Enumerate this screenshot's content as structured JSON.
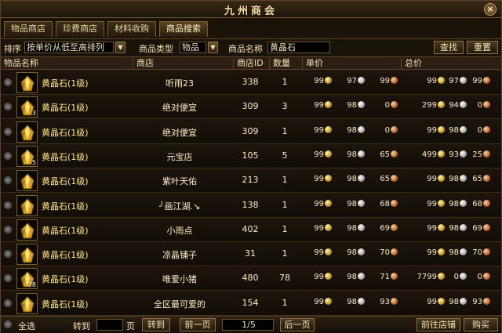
{
  "window": {
    "title": "九州商会",
    "close_label": "×"
  },
  "tabs": [
    {
      "label": "物品商店"
    },
    {
      "label": "珍费商店"
    },
    {
      "label": "材料收购"
    },
    {
      "label": "商品搜索"
    }
  ],
  "filters": {
    "sort_label": "排序",
    "sort_value": "按单价从低至高排列",
    "type_label": "商品类型",
    "type_value": "物品",
    "name_label": "商品名称",
    "name_value": "黄晶石",
    "search_button": "查找",
    "reset_button": "重置"
  },
  "columns": [
    "物品名称",
    "商店",
    "商店ID",
    "数量",
    "单价",
    "总价"
  ],
  "colors": {
    "gold": "#d8a52a",
    "silver": "#b0b0b0",
    "copper": "#b9672f"
  },
  "rows": [
    {
      "name": "黄晶石(1级)",
      "stack": "",
      "shop": "听雨23",
      "shop_id": "338",
      "qty": "1",
      "unit": [
        "99",
        "97",
        "99"
      ],
      "total": [
        "99",
        "97",
        "99"
      ]
    },
    {
      "name": "黄晶石(1级)",
      "stack": "3",
      "shop": "绝对便宜",
      "shop_id": "309",
      "qty": "3",
      "unit": [
        "99",
        "98",
        "0"
      ],
      "total": [
        "299",
        "94",
        "0"
      ]
    },
    {
      "name": "黄晶石(1级)",
      "stack": "",
      "shop": "绝对便宜",
      "shop_id": "309",
      "qty": "1",
      "unit": [
        "99",
        "98",
        "0"
      ],
      "total": [
        "99",
        "98",
        "0"
      ]
    },
    {
      "name": "黄晶石(1级)",
      "stack": "5",
      "shop": "元宝店",
      "shop_id": "105",
      "qty": "5",
      "unit": [
        "99",
        "98",
        "65"
      ],
      "total": [
        "499",
        "93",
        "25"
      ]
    },
    {
      "name": "黄晶石(1级)",
      "stack": "",
      "shop": "紫叶天佑",
      "shop_id": "213",
      "qty": "1",
      "unit": [
        "99",
        "98",
        "65"
      ],
      "total": [
        "99",
        "98",
        "65"
      ]
    },
    {
      "name": "黄晶石(1级)",
      "stack": "",
      "shop": "╯画江湖.↘",
      "shop_id": "138",
      "qty": "1",
      "unit": [
        "99",
        "98",
        "68"
      ],
      "total": [
        "99",
        "98",
        "68"
      ]
    },
    {
      "name": "黄晶石(1级)",
      "stack": "",
      "shop": "小雨点",
      "shop_id": "402",
      "qty": "1",
      "unit": [
        "99",
        "98",
        "69"
      ],
      "total": [
        "99",
        "98",
        "69"
      ]
    },
    {
      "name": "黄晶石(1级)",
      "stack": "",
      "shop": "凉晶铺子",
      "shop_id": "31",
      "qty": "1",
      "unit": [
        "99",
        "98",
        "70"
      ],
      "total": [
        "99",
        "98",
        "70"
      ]
    },
    {
      "name": "黄晶石(1级)",
      "stack": "78",
      "shop": "唯爱小猪",
      "shop_id": "480",
      "qty": "78",
      "unit": [
        "99",
        "98",
        "71"
      ],
      "total": [
        "7799",
        "0",
        "0"
      ]
    },
    {
      "name": "黄晶石(1级)",
      "stack": "",
      "shop": "全区最可爱的",
      "shop_id": "154",
      "qty": "1",
      "unit": [
        "99",
        "98",
        "93"
      ],
      "total": [
        "99",
        "98",
        "93"
      ]
    }
  ],
  "footer": {
    "select_all": "全选",
    "goto_label": "转到",
    "goto_value": "",
    "page_unit": "页",
    "goto_button": "转到",
    "prev_button": "前一页",
    "page_indicator": "1/5",
    "next_button": "后一页",
    "visit_shop_button": "前往店铺",
    "buy_button": "购买"
  }
}
